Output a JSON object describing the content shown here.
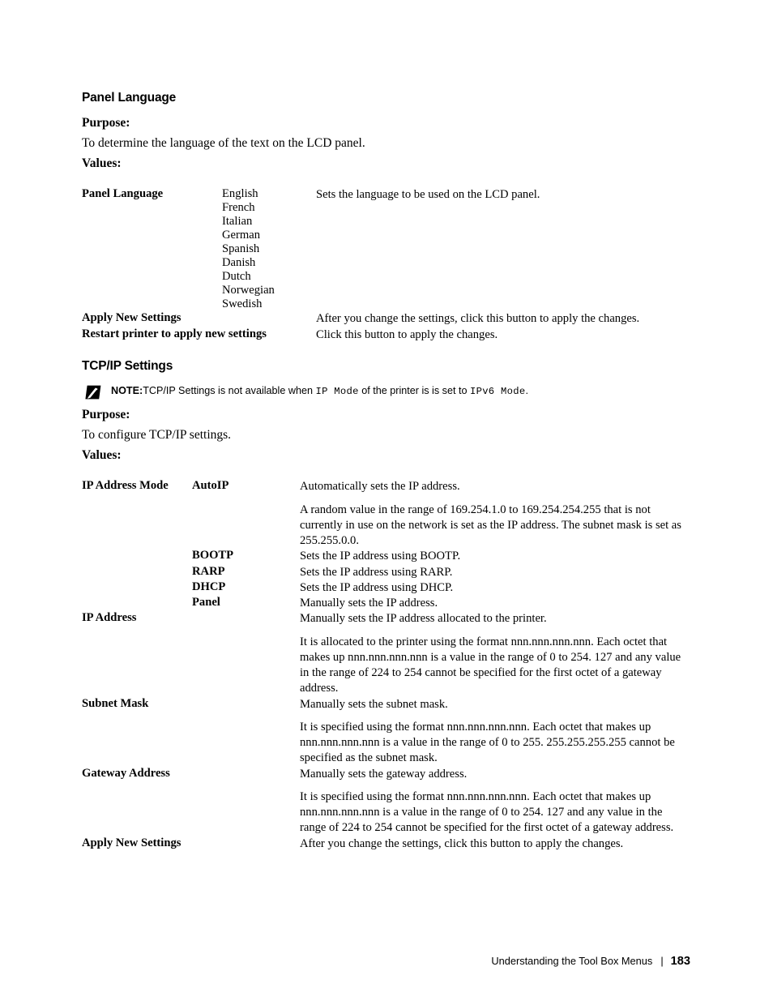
{
  "sections": [
    {
      "heading": "Panel Language",
      "purpose_label": "Purpose:",
      "purpose_text": "To determine the language of the text on the LCD panel.",
      "values_label": "Values:"
    },
    {
      "heading": "TCP/IP Settings",
      "note": {
        "icon": "pencil-note-icon",
        "label": "NOTE:",
        "text_part1": "TCP/IP Settings is not available when ",
        "mono1": "IP Mode",
        "text_part2": " of the printer is is set to ",
        "mono2": "IPv6 Mode",
        "text_part3": "."
      },
      "purpose_label": "Purpose:",
      "purpose_text": "To configure TCP/IP settings.",
      "values_label": "Values:"
    }
  ],
  "panel_language_table": {
    "row_label": "Panel Language",
    "languages": [
      "English",
      "French",
      "Italian",
      "German",
      "Spanish",
      "Danish",
      "Dutch",
      "Norwegian",
      "Swedish"
    ],
    "language_description": "Sets the language to be used on the LCD panel.",
    "footer_rows": [
      {
        "label": "Apply New Settings",
        "description": "After you change the settings, click this button to apply the changes."
      },
      {
        "label": "Restart printer to apply new settings",
        "description": "Click this button to apply the changes."
      }
    ]
  },
  "tcpip_table": {
    "ip_address_mode": {
      "label": "IP Address Mode",
      "options": [
        {
          "value": "AutoIP",
          "descriptions": [
            "Automatically sets the IP address.",
            "A random value in the range of 169.254.1.0 to 169.254.254.255 that is not currently in use on the network is set as the IP address. The subnet mask is set as 255.255.0.0."
          ]
        },
        {
          "value": "BOOTP",
          "descriptions": [
            "Sets the IP address using BOOTP."
          ]
        },
        {
          "value": "RARP",
          "descriptions": [
            "Sets the IP address using RARP."
          ]
        },
        {
          "value": "DHCP",
          "descriptions": [
            "Sets the IP address using DHCP."
          ]
        },
        {
          "value": "Panel",
          "descriptions": [
            "Manually sets the IP address."
          ]
        }
      ]
    },
    "simple_rows": [
      {
        "label": "IP Address",
        "descriptions": [
          "Manually sets the IP address allocated to the printer.",
          "It is allocated to the printer using the format nnn.nnn.nnn.nnn. Each octet that makes up nnn.nnn.nnn.nnn is a value in the range of 0 to 254. 127 and any value in the range of 224 to 254 cannot be specified for the first octet of a gateway address."
        ]
      },
      {
        "label": "Subnet Mask",
        "descriptions": [
          "Manually sets the subnet mask.",
          "It is specified using the format nnn.nnn.nnn.nnn. Each octet that makes up nnn.nnn.nnn.nnn is a value in the range of 0 to 255. 255.255.255.255 cannot be specified as the subnet mask."
        ]
      },
      {
        "label": "Gateway Address",
        "descriptions": [
          "Manually sets the gateway address.",
          "It is specified using the format nnn.nnn.nnn.nnn. Each octet that makes up nnn.nnn.nnn.nnn is a value in the range of 0 to 254. 127 and any value in the range of 224 to 254 cannot be specified for the first octet of a gateway address."
        ]
      },
      {
        "label": "Apply New Settings",
        "descriptions": [
          "After you change the settings, click this button to apply the changes."
        ]
      }
    ]
  },
  "footer": {
    "chapter": "Understanding the Tool Box Menus",
    "separator": "|",
    "page_number": "183"
  }
}
